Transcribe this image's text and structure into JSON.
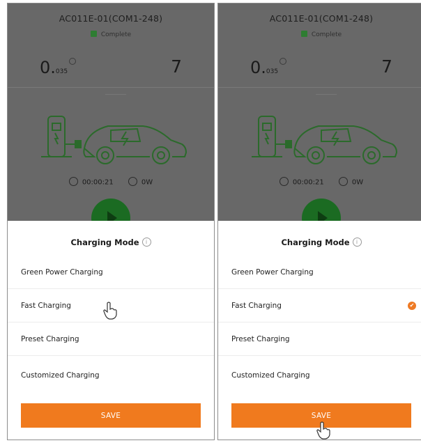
{
  "panels": [
    {
      "device_id": "AC011E-01(COM1-248)",
      "status": "Complete",
      "energy_value": "0.",
      "energy_unit": "035",
      "count_value": "7",
      "elapsed_time": "00:00:21",
      "power": "0W",
      "sheet_title": "Charging Mode",
      "info_glyph": "i",
      "modes": [
        "Green Power Charging",
        "Fast Charging",
        "Preset Charging",
        "Customized Charging"
      ],
      "save_label": "SAVE",
      "selected_mode": null
    },
    {
      "device_id": "AC011E-01(COM1-248)",
      "status": "Complete",
      "energy_value": "0.",
      "energy_unit": "035",
      "count_value": "7",
      "elapsed_time": "00:00:21",
      "power": "0W",
      "sheet_title": "Charging Mode",
      "info_glyph": "i",
      "modes": [
        "Green Power Charging",
        "Fast Charging",
        "Preset Charging",
        "Customized Charging"
      ],
      "save_label": "SAVE",
      "selected_mode": "Fast Charging",
      "check_glyph": "✔"
    }
  ],
  "colors": {
    "accent": "#f07a1e",
    "overlay": "#686868",
    "status_green": "#2e7d32",
    "play_green": "#1b6b22"
  },
  "icons": [
    "clock-icon",
    "power-icon",
    "info-icon",
    "play-icon",
    "check-icon",
    "hand-cursor-icon",
    "charger-car-icon"
  ]
}
